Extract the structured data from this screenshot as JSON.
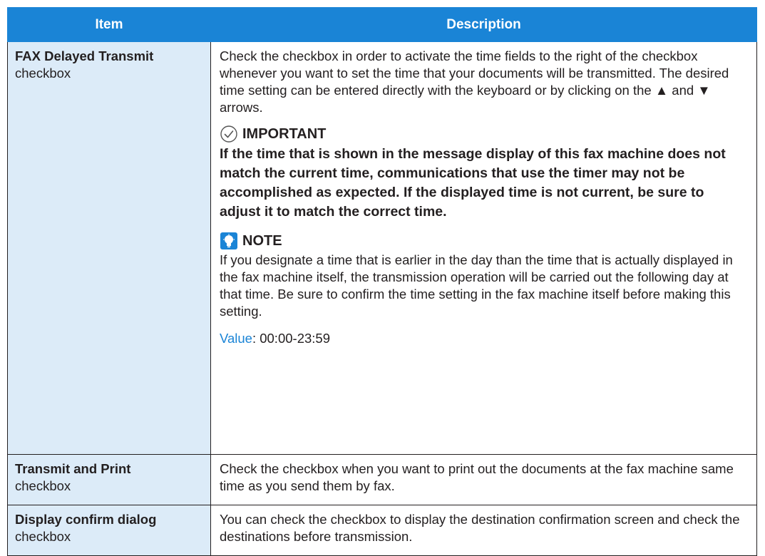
{
  "table": {
    "headers": {
      "item": "Item",
      "description": "Description"
    },
    "rows": [
      {
        "item_name": "FAX Delayed Transmit",
        "item_type": "checkbox",
        "description": "Check the checkbox in order to activate the time fields to the right of the checkbox whenever you want to set the time that your documents will be transmitted. The desired time setting can be entered directly with the keyboard or by clicking on the ▲ and ▼ arrows.",
        "important": {
          "icon": "check-circle-icon",
          "heading": "IMPORTANT",
          "text": "If the time that is shown in the message display of this fax machine does not match the current time, communications that use the timer may not be accomplished as expected. If the displayed time is not current, be sure to adjust it to match the correct time."
        },
        "note": {
          "icon": "lightbulb-icon",
          "heading": "NOTE",
          "text": "If you designate a time that is earlier in the day than the time that is actually displayed in the fax machine itself, the transmission operation will be carried out the following day at that time. Be sure to confirm the time setting in the fax machine itself before making this setting."
        },
        "value_label": "Value",
        "value_text": ": 00:00-23:59"
      },
      {
        "item_name": "Transmit and Print",
        "item_type": "checkbox",
        "description": "Check the checkbox when you want to print out the documents at the fax machine same time as you send them by fax."
      },
      {
        "item_name": "Display confirm dialog",
        "item_type": "checkbox",
        "description": "You can check the checkbox to display the destination confirmation screen and check the destinations before transmission."
      }
    ]
  },
  "colors": {
    "header_bg": "#1a84d6",
    "item_cell_bg": "#dcebf8",
    "link_blue": "#1a84d6"
  }
}
